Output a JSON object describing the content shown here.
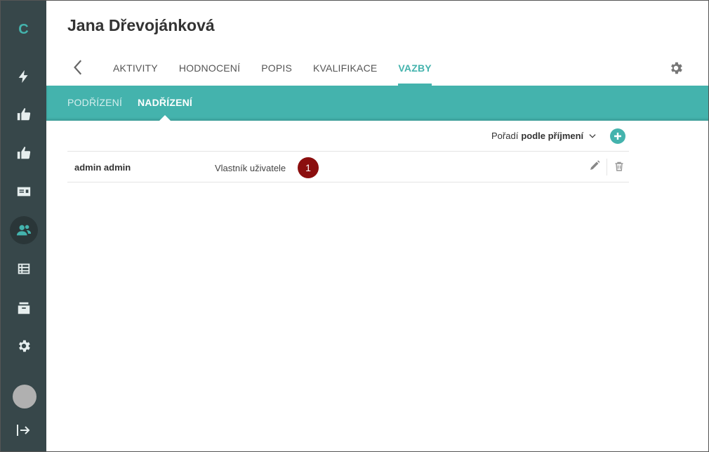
{
  "sidebar": {
    "logo": "C",
    "icons": [
      "lightning-icon",
      "thumb-up-icon",
      "thumb-up-icon",
      "id-card-icon",
      "users-icon",
      "table-icon",
      "archive-icon",
      "gear-icon"
    ],
    "active_icon": "users-icon"
  },
  "header": {
    "title": "Jana Dřevojánková",
    "tabs": [
      {
        "label": "AKTIVITY"
      },
      {
        "label": "HODNOCENÍ"
      },
      {
        "label": "POPIS"
      },
      {
        "label": "KVALIFIKACE"
      },
      {
        "label": "VAZBY",
        "active": true
      }
    ]
  },
  "subnav": {
    "tabs": [
      {
        "label": "PODŘÍZENÍ"
      },
      {
        "label": "NADŘÍZENÍ",
        "active": true
      }
    ]
  },
  "sort": {
    "label": "Pořadí",
    "value": "podle příjmení"
  },
  "rows": [
    {
      "name": "admin admin",
      "role": "Vlastník uživatele",
      "badge": "1"
    }
  ],
  "colors": {
    "accent": "#44b3ad",
    "sidebar": "#37474a",
    "badge": "#8b0e0e"
  }
}
